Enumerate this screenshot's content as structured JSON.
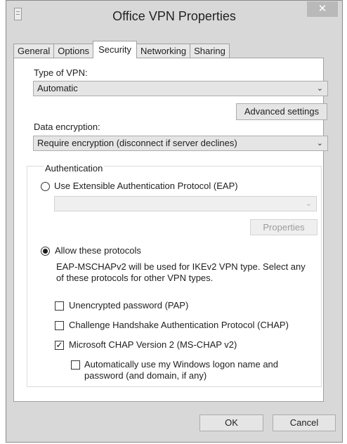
{
  "window": {
    "title": "Office VPN Properties",
    "close_glyph": "✕"
  },
  "tabs": [
    {
      "label": "General"
    },
    {
      "label": "Options"
    },
    {
      "label": "Security",
      "active": true
    },
    {
      "label": "Networking"
    },
    {
      "label": "Sharing"
    }
  ],
  "security": {
    "vpn_type_label": "Type of VPN:",
    "vpn_type_value": "Automatic",
    "advanced_settings_label": "Advanced settings",
    "encryption_label": "Data encryption:",
    "encryption_value": "Require encryption (disconnect if server declines)",
    "authentication": {
      "group_label": "Authentication",
      "eap_option": "Use Extensible Authentication Protocol (EAP)",
      "eap_selected": false,
      "eap_method_value": "",
      "properties_label": "Properties",
      "allow_option": "Allow these protocols",
      "allow_selected": true,
      "description": "EAP-MSCHAPv2 will be used for IKEv2 VPN type. Select any of these protocols for other VPN types.",
      "protocols": [
        {
          "label": "Unencrypted password (PAP)",
          "checked": false
        },
        {
          "label": "Challenge Handshake Authentication Protocol (CHAP)",
          "checked": false
        },
        {
          "label": "Microsoft CHAP Version 2 (MS-CHAP v2)",
          "checked": true
        }
      ],
      "auto_logon_label": "Automatically use my Windows logon name and password (and domain, if any)",
      "auto_logon_checked": false
    }
  },
  "footer": {
    "ok_label": "OK",
    "cancel_label": "Cancel"
  },
  "icons": {
    "dropdown": "⌄",
    "check": "✓"
  },
  "colors": {
    "window_chrome": "#d8d8d8",
    "close_button": "#b9b9b9",
    "panel": "#ffffff",
    "disabled_text": "#9c9c9c"
  }
}
